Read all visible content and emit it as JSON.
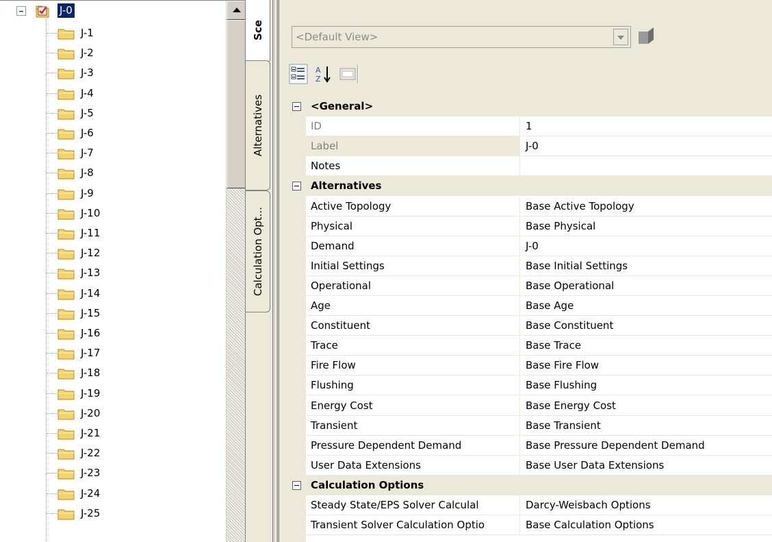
{
  "tree": {
    "root_label": "J-0",
    "items": [
      "J-1",
      "J-2",
      "J-3",
      "J-4",
      "J-5",
      "J-6",
      "J-7",
      "J-8",
      "J-9",
      "J-10",
      "J-11",
      "J-12",
      "J-13",
      "J-14",
      "J-15",
      "J-16",
      "J-17",
      "J-18",
      "J-19",
      "J-20",
      "J-21",
      "J-22",
      "J-23",
      "J-24",
      "J-25"
    ]
  },
  "tabs": [
    {
      "label": "Sce",
      "active": true
    },
    {
      "label": "Alternatives",
      "active": false
    },
    {
      "label": "Calculation Opt...",
      "active": false
    }
  ],
  "view_selector": {
    "value": "<Default View>"
  },
  "toolbar": {
    "categorized_icon": "categorized-view-icon",
    "alphabetical_icon": "sort-alphabetical-icon",
    "property_pages_icon": "property-pages-icon"
  },
  "grid": {
    "sections": [
      {
        "title": "<General>",
        "rows": [
          {
            "name": "ID",
            "value": "1"
          },
          {
            "name": "Label",
            "value": "J-0"
          },
          {
            "name": "Notes",
            "value": ""
          }
        ]
      },
      {
        "title": "Alternatives",
        "rows": [
          {
            "name": "Active Topology",
            "value": "Base Active Topology"
          },
          {
            "name": "Physical",
            "value": "Base Physical"
          },
          {
            "name": "Demand",
            "value": "J-0"
          },
          {
            "name": "Initial Settings",
            "value": "Base Initial Settings"
          },
          {
            "name": "Operational",
            "value": "Base Operational"
          },
          {
            "name": "Age",
            "value": "Base Age"
          },
          {
            "name": "Constituent",
            "value": "Base Constituent"
          },
          {
            "name": "Trace",
            "value": "Base Trace"
          },
          {
            "name": "Fire Flow",
            "value": "Base Fire Flow"
          },
          {
            "name": "Flushing",
            "value": "Base Flushing"
          },
          {
            "name": "Energy Cost",
            "value": "Base Energy Cost"
          },
          {
            "name": "Transient",
            "value": "Base Transient"
          },
          {
            "name": "Pressure Dependent Demand",
            "value": "Base Pressure Dependent Demand"
          },
          {
            "name": "User Data Extensions",
            "value": "Base User Data Extensions"
          }
        ]
      },
      {
        "title": "Calculation Options",
        "rows": [
          {
            "name": "Steady State/EPS Solver Calculal",
            "value": "Darcy-Weisbach Options"
          },
          {
            "name": "Transient Solver Calculation Optio",
            "value": "Base Calculation Options"
          }
        ]
      }
    ]
  },
  "colors": {
    "selection": "#0a246a",
    "folder": "#f4d46a",
    "panel_bg": "#ece9d8"
  }
}
